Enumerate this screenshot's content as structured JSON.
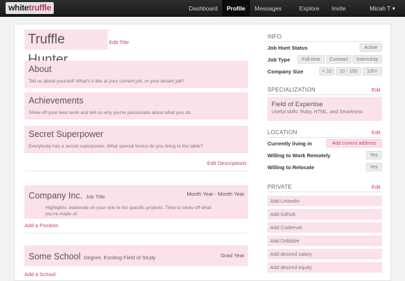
{
  "nav": {
    "logo_a": "white",
    "logo_b": "truffle",
    "items": [
      "Dashboard",
      "Profile",
      "Messages",
      "Explore",
      "Invite"
    ],
    "user": "Micah T",
    "user_caret": "▾"
  },
  "profile": {
    "title": "Truffle Hunter",
    "edit_title": "Edit Title",
    "sections": [
      {
        "heading": "About",
        "desc": "Tell us about yourself! What's it like at your current job, or your dream job?"
      },
      {
        "heading": "Achievements",
        "desc": "Show off your best work and tell us why you're passionate about what you do."
      },
      {
        "heading": "Secret Superpower",
        "desc": "Everybody has a secret superpower. What special bonus do you bring to the table?"
      }
    ],
    "edit_descriptions": "Edit Descriptions",
    "company": {
      "name": "Company Inc.",
      "role": "Job Title",
      "dates": "Month Year - Month Year",
      "desc": "Highlights: elaborate on your role or list specific projects. Time to show off what you're made of."
    },
    "add_position": "Add a Position",
    "school": {
      "name": "Some School",
      "degree": "Degree, Exciting Field of Study",
      "year": "Grad Year"
    },
    "add_school": "Add a School"
  },
  "sidebar": {
    "info": {
      "heading": "INFO",
      "job_hunt_label": "Job Hunt Status",
      "job_hunt_value": "Active",
      "job_type_label": "Job Type",
      "job_types": [
        "Full-time",
        "Contract",
        "Internship"
      ],
      "company_size_label": "Company Size",
      "company_sizes": [
        "< 10",
        "10 - 100",
        "100+"
      ]
    },
    "specialization": {
      "heading": "SPECIALIZATION",
      "edit": "Edit",
      "title": "Field of Expertise",
      "desc": "Useful skills: Ruby, HTML, and Smartness"
    },
    "location": {
      "heading": "LOCATION",
      "edit": "Edit",
      "living_label": "Currently living in",
      "living_value": "Add current address",
      "remote_label": "Willing to Work Remotely",
      "remote_value": "Yes",
      "relocate_label": "Willing to Relocate",
      "relocate_value": "Yes"
    },
    "private": {
      "heading": "PRIVATE",
      "edit": "Edit",
      "items": [
        "Add LinkedIn",
        "Add Github",
        "Add Codeeval",
        "Add Dribbble",
        "Add desired salary",
        "Add desired equity"
      ]
    }
  }
}
